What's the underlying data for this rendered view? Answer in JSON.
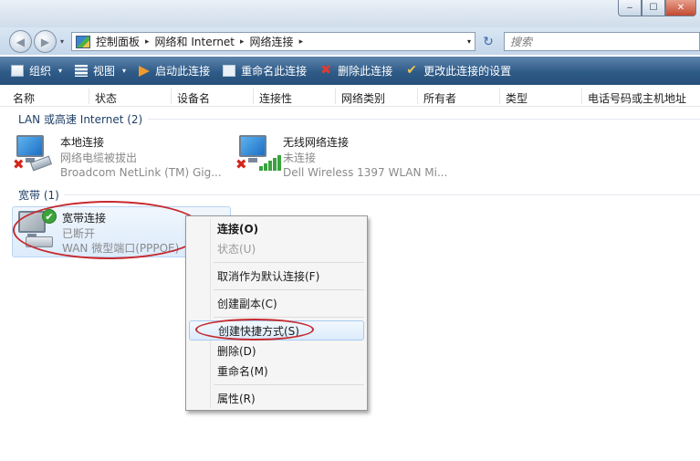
{
  "window": {
    "minimize_glyph": "‒",
    "maximize_glyph": "☐",
    "close_glyph": "✕"
  },
  "nav": {
    "back_glyph": "◀",
    "forward_glyph": "▶",
    "dropdown_glyph": "▾",
    "breadcrumb": [
      "控制面板",
      "网络和 Internet",
      "网络连接"
    ],
    "crumb_sep": "▸",
    "addr_dropdown_glyph": "▾",
    "refresh_glyph": "↻",
    "search_placeholder": "搜索"
  },
  "toolbar": {
    "organize": "组织",
    "view": "视图",
    "start": "启动此连接",
    "rename": "重命名此连接",
    "delete": "删除此连接",
    "change": "更改此连接的设置",
    "caret": "▾",
    "delete_glyph": "✖",
    "change_glyph": "✔"
  },
  "columns": [
    "名称",
    "状态",
    "设备名",
    "连接性",
    "网络类别",
    "所有者",
    "类型",
    "电话号码或主机地址"
  ],
  "groups": {
    "lan": {
      "title": "LAN 或高速 Internet (2)",
      "items": [
        {
          "name": "本地连接",
          "status": "网络电缆被拔出",
          "device": "Broadcom NetLink (TM) Gig..."
        },
        {
          "name": "无线网络连接",
          "status": "未连接",
          "device": "Dell Wireless 1397 WLAN Mi..."
        }
      ]
    },
    "broadband": {
      "title": "宽带 (1)",
      "items": [
        {
          "name": "宽带连接",
          "status": "已断开",
          "device": "WAN 微型端口(PPPOE)"
        }
      ]
    }
  },
  "badges": {
    "x_glyph": "✖",
    "check_glyph": "✔"
  },
  "context_menu": {
    "connect": "连接(O)",
    "status": "状态(U)",
    "cancel_default": "取消作为默认连接(F)",
    "create_copy": "创建副本(C)",
    "create_shortcut": "创建快捷方式(S)",
    "delete": "删除(D)",
    "rename": "重命名(M)",
    "properties": "属性(R)"
  },
  "colors": {
    "annotation_red": "#c62a2f",
    "toolbar_blue": "#2f5b88",
    "group_title": "#1e3f66"
  }
}
